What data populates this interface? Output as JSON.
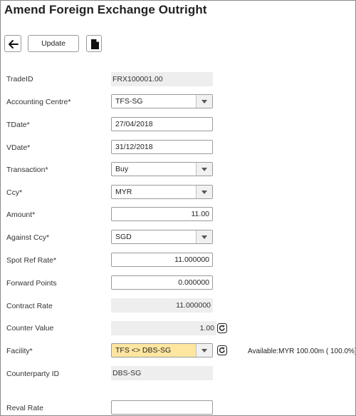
{
  "header": {
    "title": "Amend Foreign Exchange Outright"
  },
  "toolbar": {
    "back_icon": "left-arrow-icon",
    "update_label": "Update",
    "document_icon": "document-icon"
  },
  "form": {
    "trade_id": {
      "label": "TradeID",
      "value": "FRX100001.00"
    },
    "accounting_centre": {
      "label": "Accounting Centre*",
      "value": "TFS-SG"
    },
    "tdate": {
      "label": "TDate*",
      "value": "27/04/2018"
    },
    "vdate": {
      "label": "VDate*",
      "value": "31/12/2018"
    },
    "transaction": {
      "label": "Transaction*",
      "value": "Buy"
    },
    "ccy": {
      "label": "Ccy*",
      "value": "MYR"
    },
    "amount": {
      "label": "Amount*",
      "value": "11.00"
    },
    "against_ccy": {
      "label": "Against Ccy*",
      "value": "SGD"
    },
    "spot_ref_rate": {
      "label": "Spot Ref Rate*",
      "value": "11.000000"
    },
    "forward_points": {
      "label": "Forward Points",
      "value": "0.000000"
    },
    "contract_rate": {
      "label": "Contract Rate",
      "value": "11.000000"
    },
    "counter_value": {
      "label": "Counter Value",
      "value": "1.00"
    },
    "facility": {
      "label": "Facility*",
      "value": "TFS <> DBS-SG",
      "available": "Available:MYR 100.00m ( 100.0%)"
    },
    "counterparty_id": {
      "label": "Counterparty ID",
      "value": "DBS-SG"
    },
    "reval_rate": {
      "label": "Reval Rate",
      "value": ""
    }
  },
  "colors": {
    "facility_highlight": "#ffe6a0",
    "readonly_bg": "#eeeeee",
    "border": "#9a9a9a"
  },
  "icons": [
    "left-arrow-icon",
    "document-icon",
    "chevron-down-icon",
    "refresh-icon"
  ]
}
